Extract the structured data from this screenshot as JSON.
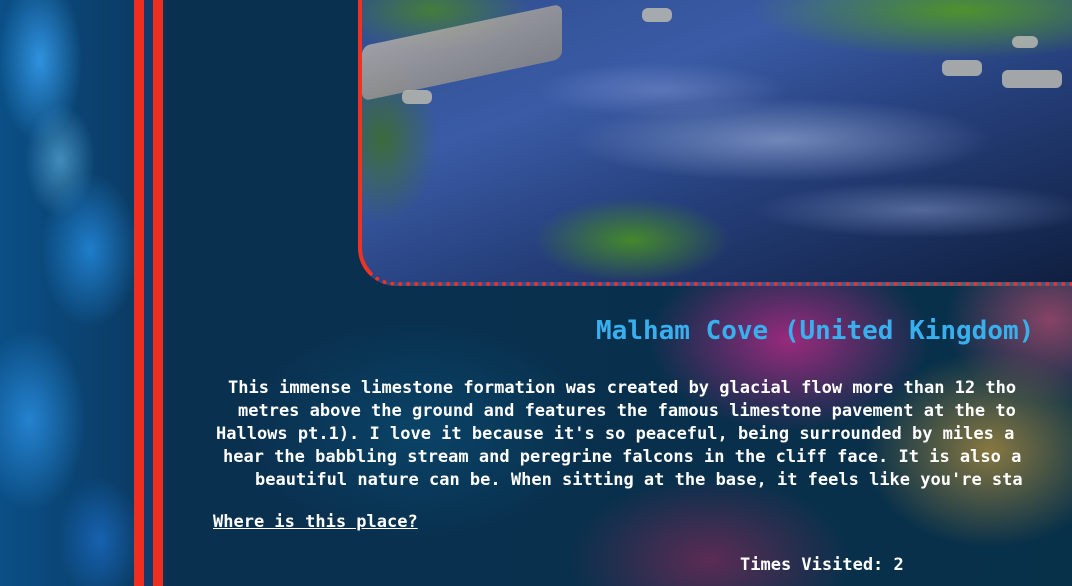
{
  "place": {
    "title": "Malham Cove (United Kingdom)",
    "description_lines": [
      "This immense limestone formation was created by glacial flow more than 12 tho",
      "metres above the ground and features the famous limestone pavement at the to",
      "Hallows pt.1). I love it because it's so peaceful, being surrounded by miles a",
      "hear the babbling stream and peregrine falcons in the cliff face. It is also a",
      "beautiful nature can be. When sitting at the base, it feels like you're sta"
    ],
    "location_link": "Where is this place?",
    "times_visited": "Times Visited: 2"
  },
  "colors": {
    "accent_red": "#ee2f1f",
    "title_blue": "#38b0ee"
  }
}
